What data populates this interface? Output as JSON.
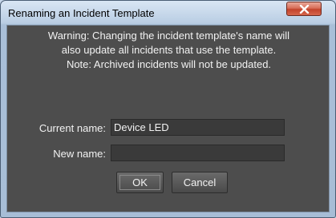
{
  "window": {
    "title": "Renaming an Incident Template",
    "close_icon": "close-icon"
  },
  "warning": {
    "line1": "Warning: Changing the incident template's name will",
    "line2": "also update all incidents that use the template.",
    "line3": "Note: Archived incidents will not be updated."
  },
  "form": {
    "current_name_label": "Current name:",
    "current_name_value": "Device LED",
    "new_name_label": "New name:",
    "new_name_value": ""
  },
  "buttons": {
    "ok_label": "OK",
    "cancel_label": "Cancel"
  },
  "colors": {
    "dialog_background": "#4d4d4d",
    "title_bar": "#b9cde3",
    "close_button": "#c2432b"
  }
}
